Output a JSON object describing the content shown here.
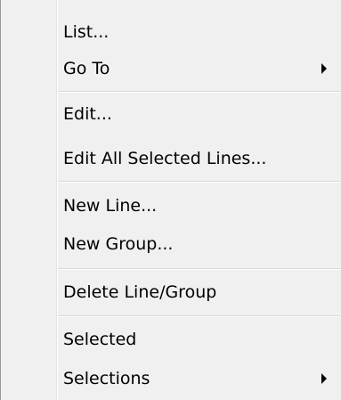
{
  "menu": {
    "items": [
      {
        "label": "List...",
        "has_submenu": false
      },
      {
        "label": "Go To",
        "has_submenu": true
      },
      {
        "label": "Edit...",
        "has_submenu": false
      },
      {
        "label": "Edit All Selected Lines...",
        "has_submenu": false
      },
      {
        "label": "New Line...",
        "has_submenu": false
      },
      {
        "label": "New Group...",
        "has_submenu": false
      },
      {
        "label": "Delete Line/Group",
        "has_submenu": false
      },
      {
        "label": "Selected",
        "has_submenu": false
      },
      {
        "label": "Selections",
        "has_submenu": true
      }
    ],
    "submenu_icon": "chevron-right-icon",
    "colors": {
      "background": "#f0f0f0",
      "text": "#000000",
      "separator": "#d7d7d7"
    }
  }
}
